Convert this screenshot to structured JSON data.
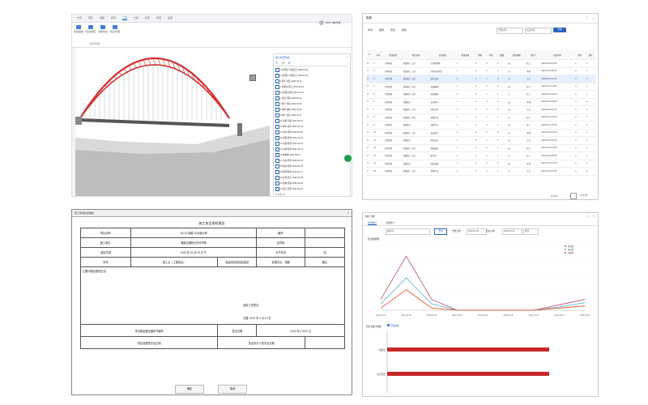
{
  "bim_panel": {
    "tabs": [
      "文件",
      "首页",
      "视图",
      "模型",
      "工具",
      "分析",
      "检查",
      "协同",
      "设置"
    ],
    "active_tab_index": 4,
    "ribbon_buttons": [
      "检查报告",
      "隐患排查",
      "问题列表",
      "视点管理"
    ],
    "ribbon_group_label": "检查管理",
    "user_label": "admin 湖南交通",
    "tree_title": "施工检查列表",
    "tree_rows": [
      "1 主拱肋 节段施工 2022.04.09",
      "2 主拱肋 节段施工 2022.04.10",
      "3 吊杆 安装 2022.04.11",
      "4 桥面系 施工 2022.04.12",
      "5 主拱肋 检查 2022.04.13",
      "6 系梁 浇筑 2022.04.14",
      "7 吊杆 张拉 2022.04.15",
      "8 桥面 铺装 2022.04.16",
      "9 护栏 安装 2022.04.17",
      "10 主拱 涂装 2022.04.18",
      "11 检查 复查 2022.04.19",
      "12 吊杆 检查 2022.04.20",
      "13 桥面 检查 2022.04.21",
      "14 系梁 检查 2022.04.22",
      "15 主拱 复查 2022.04.23",
      "16 伸缩缝 2022.04.24",
      "17 支座 检查 2022.04.25",
      "18 排水 检查 2022.04.26",
      "19 照明 检查 2022.04.27",
      "20 标线 施工 2022.04.28",
      "21 验收 准备 2022.04.29",
      "22 竣工 检查 2022.04.30"
    ],
    "tree_pager": "共22条 1/1",
    "colors": {
      "arch": "#d32f2f",
      "accent": "#1565c0"
    }
  },
  "list_panel": {
    "title": "隐患",
    "toolbar": [
      "新增",
      "删除",
      "导出",
      "刷新"
    ],
    "search_labels": [
      "开始时间",
      "结束时间",
      "查询"
    ],
    "headers": [
      "序号",
      "检查类型",
      "项目名称",
      "检查部位",
      "隐患描述",
      "等级",
      "状态",
      "数量",
      "整改期限",
      "责任人",
      "检查时间",
      "附件",
      "操作"
    ],
    "rows": [
      [
        "1",
        "专项检查",
        "桥梁施工 上部",
        "主拱肋焊缝",
        "1",
        "3",
        "0",
        "2",
        "未",
        "张三",
        "2022-04-09 10:20"
      ],
      [
        "2",
        "专项检查",
        "桥梁施工 上部",
        "吊杆张拉检查",
        "1",
        "2",
        "0",
        "1",
        "未",
        "李四",
        "2022-04-10 09:15"
      ],
      [
        "3",
        "日常检查",
        "桥梁施工 下部",
        "临时支架",
        "2",
        "1",
        "1",
        "0",
        "已",
        "王五",
        "2022-04-11 14:30"
      ],
      [
        "4",
        "日常检查",
        "桥梁施工 下部",
        "系梁模板",
        "1",
        "4",
        "0",
        "3",
        "未",
        "赵六",
        "2022-04-12 11:05"
      ],
      [
        "5",
        "专项检查",
        "桥梁施工 上部",
        "桥面钢筋",
        "3",
        "2",
        "1",
        "1",
        "已",
        "张三",
        "2022-04-13 16:40"
      ],
      [
        "6",
        "日常检查",
        "桥梁施工",
        "安全防护",
        "1",
        "1",
        "0",
        "0",
        "未",
        "李四",
        "2022-04-14 08:50"
      ],
      [
        "7",
        "专项检查",
        "桥梁施工 上部",
        "拱肋吊装",
        "2",
        "3",
        "0",
        "2",
        "未",
        "王五",
        "2022-04-15 10:10"
      ],
      [
        "8",
        "日常检查",
        "桥梁施工 下部",
        "基础开挖",
        "1",
        "2",
        "1",
        "1",
        "已",
        "赵六",
        "2022-04-16 15:25"
      ],
      [
        "9",
        "专项检查",
        "桥梁施工",
        "高处作业",
        "1",
        "1",
        "0",
        "1",
        "未",
        "张三",
        "2022-04-17 09:35"
      ],
      [
        "10",
        "日常检查",
        "桥梁施工 上部",
        "临边防护",
        "2",
        "2",
        "0",
        "0",
        "已",
        "李四",
        "2022-04-18 13:20"
      ],
      [
        "11",
        "专项检查",
        "桥梁施工",
        "用电安全",
        "1",
        "3",
        "1",
        "2",
        "未",
        "王五",
        "2022-04-19 10:45"
      ],
      [
        "12",
        "日常检查",
        "桥梁施工 下部",
        "机械设备",
        "1",
        "1",
        "0",
        "1",
        "未",
        "赵六",
        "2022-04-20 14:05"
      ],
      [
        "13",
        "专项检查",
        "桥梁施工 上部",
        "脚手架",
        "3",
        "2",
        "0",
        "1",
        "已",
        "张三",
        "2022-04-21 09:55"
      ],
      [
        "14",
        "日常检查",
        "桥梁施工",
        "消防设施",
        "1",
        "1",
        "0",
        "0",
        "未",
        "李四",
        "2022-04-22 16:15"
      ],
      [
        "15",
        "专项检查",
        "桥梁施工 上部",
        "焊接作业",
        "2",
        "2",
        "1",
        "1",
        "已",
        "王五",
        "2022-04-23 11:30"
      ]
    ],
    "selected_row": 2,
    "pager": "共15条",
    "pager_size": "20条/页"
  },
  "report_panel": {
    "window_title": "施工现场检查报告",
    "title": "施工安全巡检报告",
    "project_label": "项目名称:",
    "project_value": "AZ-02-钢梁-青水塘大桥",
    "code_label": "编号:",
    "unit_label": "施工单位:",
    "unit_value": "湖南交通职业技术学院",
    "contract_label": "合同段:",
    "date_label": "巡检日期",
    "date_value": "2022 年 04 月 09 日   午",
    "weather_label": "天气情况",
    "weather_value": "晴",
    "col_seq": "序号",
    "col_location": "施工点（工程地点）",
    "col_desc": "隐患或危险因素描述",
    "col_action": "处理意见、措施",
    "col_note": "备注",
    "main_issues": "主要问题及整改意见:",
    "inspector_label": "巡检人员签名:",
    "sign_date": "日期:   2022  年   4  月  10  日",
    "notice_label": "安全隐患整改通知书编号",
    "issue_date_label": "发出日期",
    "issue_date_value": "2022  年   4  月10   日",
    "handle_sign_label": "项目经理签字及日期",
    "safety_sign_label": "安全负责人签字及日期",
    "confirm_button": "确定",
    "cancel_button": "取消"
  },
  "stats_panel": {
    "tabs": [
      "隐患统计",
      "问题统计"
    ],
    "filters": [
      "按时间",
      "开始日期",
      "2022-03-01",
      "结束日期",
      "2022-04-30",
      "查询",
      "按月"
    ],
    "line_chart_title": "隐患趋势图",
    "bar_chart_title": "隐患等级分布图",
    "bar_legend": "已整改数",
    "colors": {
      "red": "#c62828",
      "blue": "#1e63c2",
      "cyan": "#4fb3d9"
    }
  },
  "chart_data": [
    {
      "type": "line",
      "title": "隐患趋势图",
      "x": [
        "2022-03-01",
        "2022-03-08",
        "2022-03-15",
        "2022-03-22",
        "2022-03-29",
        "2022-04-05",
        "2022-04-12",
        "2022-04-19",
        "2022-04-26"
      ],
      "series": [
        {
          "name": "隐患数",
          "color": "#b84f6a",
          "values": [
            1,
            5,
            1,
            0,
            0,
            0,
            0,
            0.5,
            1
          ]
        },
        {
          "name": "整改数",
          "color": "#4fb3d9",
          "values": [
            0.6,
            3,
            0.6,
            0,
            0,
            0,
            0,
            0.3,
            0.7
          ]
        },
        {
          "name": "超期数",
          "color": "#e64a19",
          "values": [
            0.2,
            1.9,
            0.2,
            0,
            0,
            0,
            0,
            0.2,
            0.4
          ]
        }
      ],
      "ylim": [
        0,
        6
      ]
    },
    {
      "type": "bar",
      "title": "隐患等级分布图",
      "categories": [
        "一般隐患",
        "较大隐患"
      ],
      "values": [
        8,
        8
      ],
      "xlim": [
        0,
        10
      ]
    }
  ]
}
